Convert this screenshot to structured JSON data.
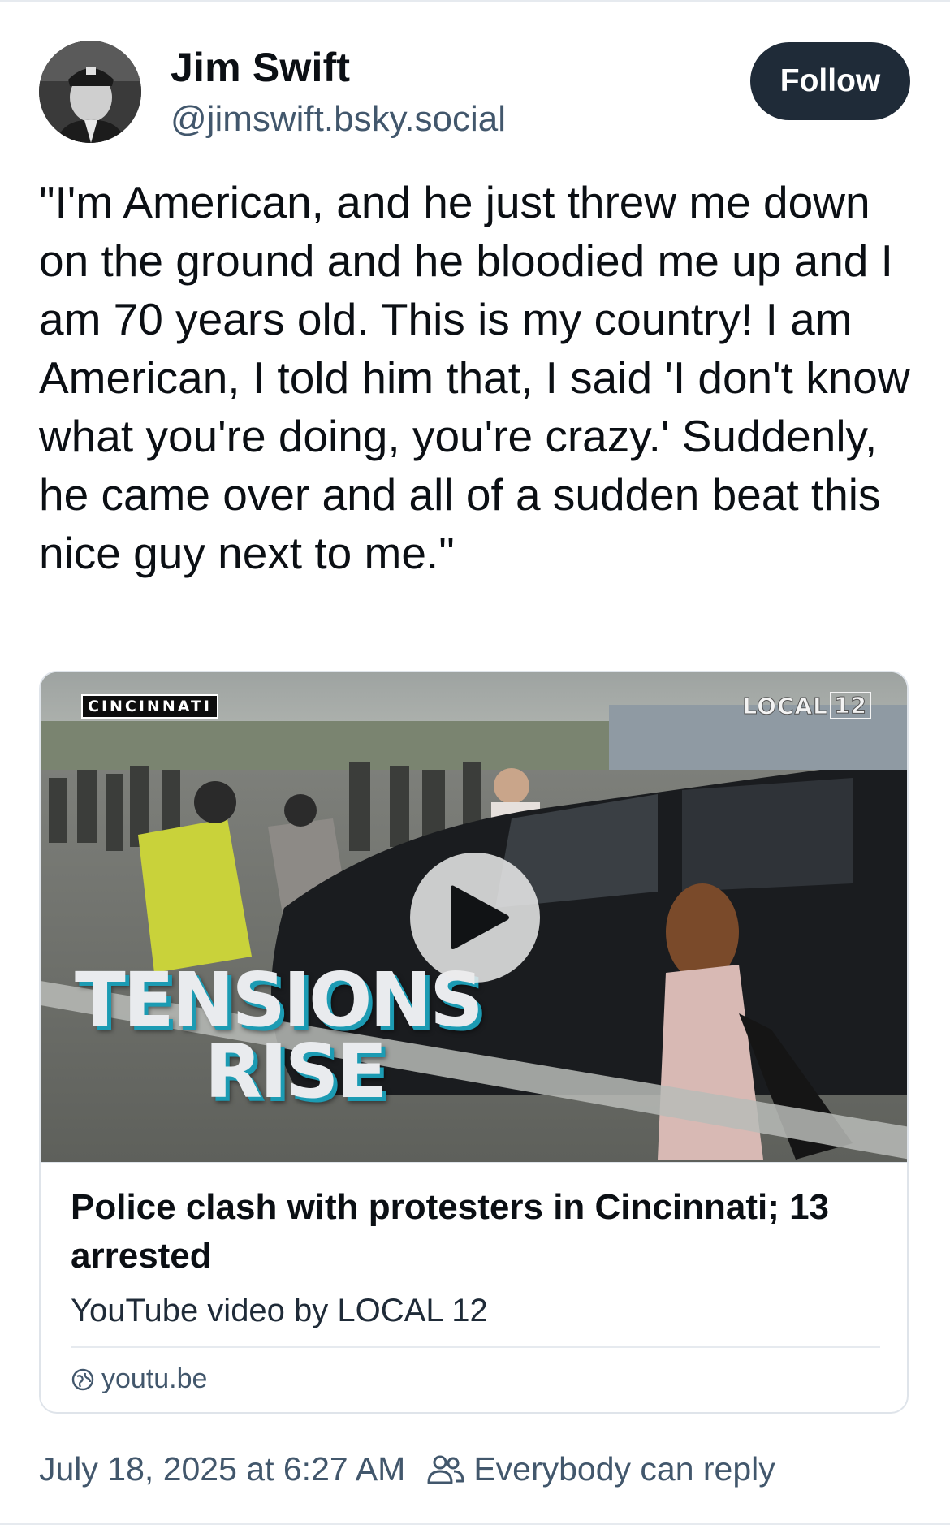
{
  "author": {
    "display_name": "Jim Swift",
    "handle": "@jimswift.bsky.social",
    "avatar_icon": "user-avatar-photo"
  },
  "follow_button": {
    "label": "Follow"
  },
  "post": {
    "text": "\"I'm American, and he just threw me down on the ground and he bloodied me up and I am 70 years old. This is my country! I am American, I told him that, I said 'I don't know what you're doing, you're crazy.' Suddenly, he came over and all of a sudden beat this nice guy next to me.\""
  },
  "embed": {
    "thumbnail": {
      "location_badge": "CINCINNATI",
      "station_badge_text": "LOCAL",
      "station_badge_number": "12",
      "overlay_line1": "TENSIONS",
      "overlay_line2": "RISE",
      "play_icon": "play-icon"
    },
    "title": "Police clash with protesters in Cincinnati; 13 arrested",
    "description": "YouTube video by LOCAL 12",
    "domain": "youtu.be",
    "domain_icon": "globe-icon"
  },
  "meta": {
    "timestamp": "July 18, 2025 at 6:27 AM",
    "reply_setting": "Everybody can reply",
    "reply_icon": "people-icon"
  },
  "colors": {
    "follow_bg": "#1f2b38",
    "secondary_text": "#42576c",
    "primary_text": "#0b0f14",
    "border": "#dfe4ea",
    "overlay_shadow": "#1c9bb3"
  }
}
